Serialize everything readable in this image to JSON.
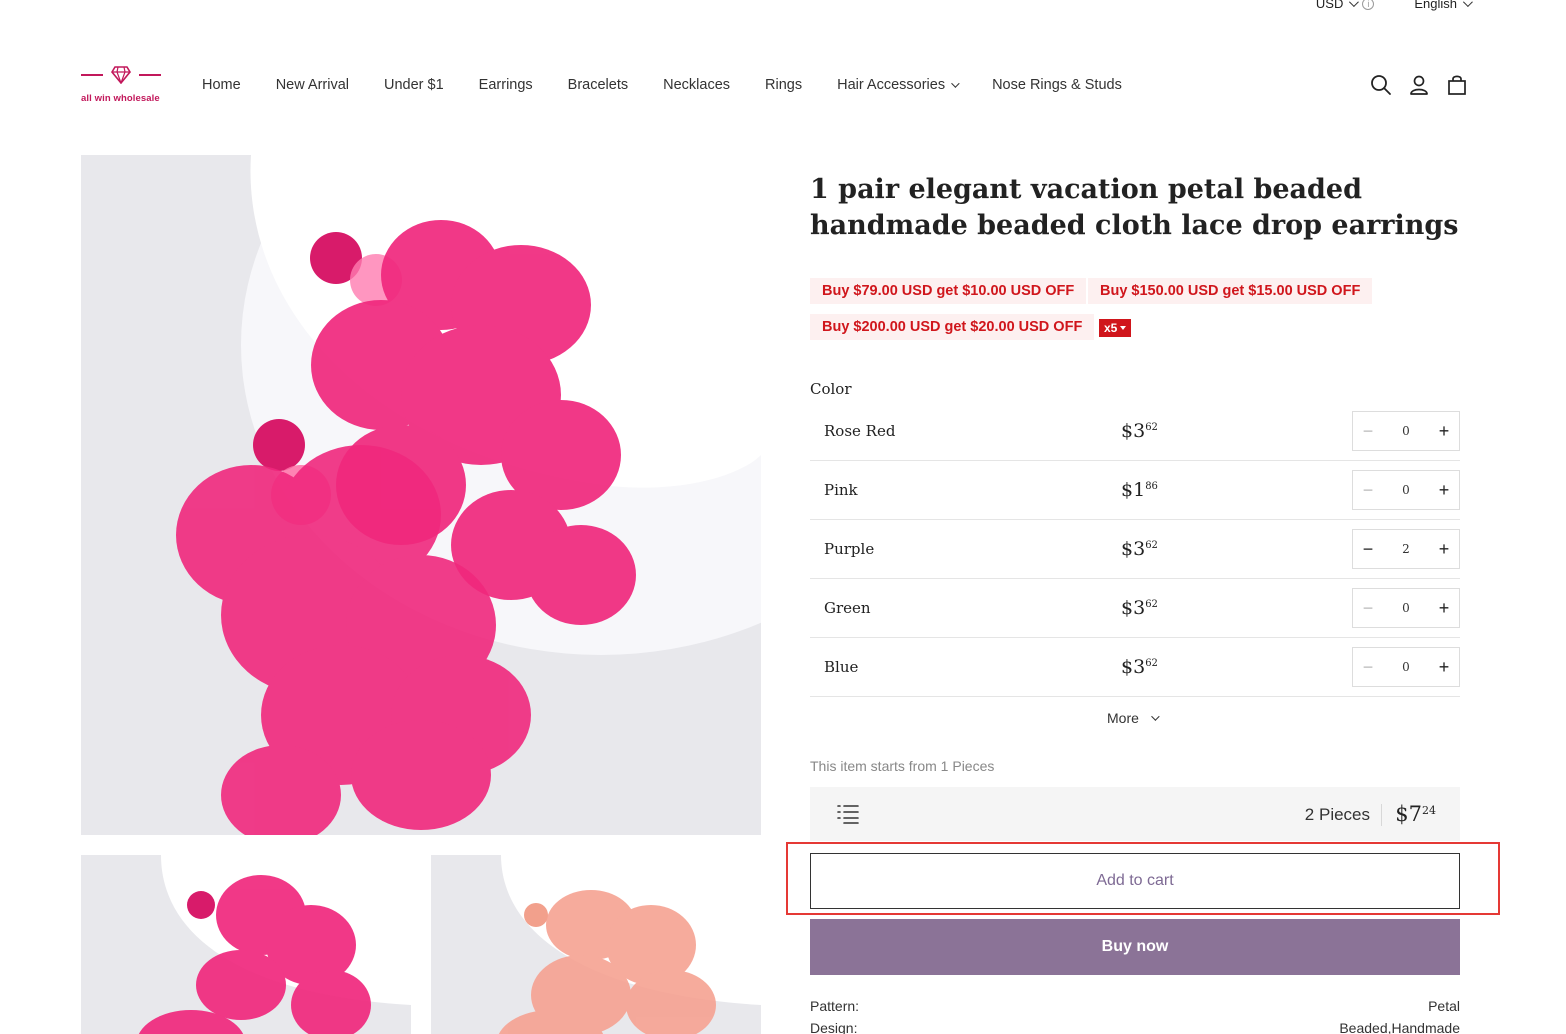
{
  "topbar": {
    "currency": "USD",
    "currency_info": "i",
    "language": "English"
  },
  "header": {
    "brand": "all win wholesale",
    "nav": [
      "Home",
      "New Arrival",
      "Under $1",
      "Earrings",
      "Bracelets",
      "Necklaces",
      "Rings",
      "Hair Accessories",
      "Nose Rings & Studs"
    ]
  },
  "product": {
    "title": "1 pair elegant vacation petal beaded handmade beaded cloth lace drop earrings",
    "promos": [
      "Buy $79.00 USD get $10.00 USD OFF",
      "Buy $150.00 USD get $15.00 USD OFF",
      "Buy $200.00 USD get $20.00 USD OFF"
    ],
    "promo_badge": "x5",
    "color_label": "Color",
    "variants": [
      {
        "name": "Rose Red",
        "price_main": "$3",
        "price_cents": "62",
        "qty": "0"
      },
      {
        "name": "Pink",
        "price_main": "$1",
        "price_cents": "86",
        "qty": "0"
      },
      {
        "name": "Purple",
        "price_main": "$3",
        "price_cents": "62",
        "qty": "2"
      },
      {
        "name": "Green",
        "price_main": "$3",
        "price_cents": "62",
        "qty": "0"
      },
      {
        "name": "Blue",
        "price_main": "$3",
        "price_cents": "62",
        "qty": "0"
      }
    ],
    "stepper_minus": "−",
    "stepper_plus": "+",
    "more_label": "More",
    "min_note": "This item starts from 1 Pieces",
    "summary": {
      "pieces": "2 Pieces",
      "total_main": "$7",
      "total_cents": "24"
    },
    "add_to_cart": "Add to cart",
    "buy_now": "Buy now",
    "specs": [
      {
        "key": "Pattern:",
        "value": "Petal"
      },
      {
        "key": "Design:",
        "value": "Beaded,Handmade"
      }
    ]
  },
  "colors": {
    "accent": "#8b7397",
    "promo_red": "#d0161c",
    "brand": "#c2185b",
    "highlight": "#e53935"
  }
}
